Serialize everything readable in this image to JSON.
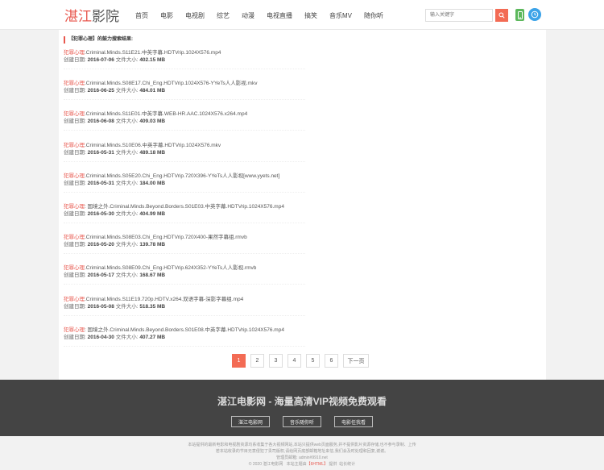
{
  "header": {
    "logo_red": "湛江",
    "logo_rest": "影院",
    "nav": [
      "首页",
      "电影",
      "电视剧",
      "综艺",
      "动漫",
      "电视直播",
      "搞笑",
      "音乐MV",
      "随你听"
    ],
    "search_placeholder": "输入关键字"
  },
  "section_title": "【犯罪心理】的鼓力搜索结果:",
  "results": [
    {
      "hl": "犯罪心理",
      "rest": ".Criminal.Minds.S11E21.中英字幕.HDTVrip.1024X576.mp4",
      "date_label": "创建日期:",
      "date": "2016-07-06",
      "size_label": "文件大小:",
      "size": "402.15 MB"
    },
    {
      "hl": "犯罪心理",
      "rest": ".Criminal.Minds.S08E17.Chi_Eng.HDTVrip.1024X576-YYeTs人人影视.mkv",
      "date_label": "创建日期:",
      "date": "2016-06-25",
      "size_label": "文件大小:",
      "size": "484.01 MB"
    },
    {
      "hl": "犯罪心理",
      "rest": ".Criminal.Minds.S11E01.中英字幕.WEB-HR.AAC.1024X576.x264.mp4",
      "date_label": "创建日期:",
      "date": "2016-06-08",
      "size_label": "文件大小:",
      "size": "409.03 MB"
    },
    {
      "hl": "犯罪心理",
      "rest": ".Criminal.Minds.S10E06.中英字幕.HDTVrip.1024X576.mkv",
      "date_label": "创建日期:",
      "date": "2016-05-31",
      "size_label": "文件大小:",
      "size": "489.18 MB"
    },
    {
      "hl": "犯罪心理",
      "rest": ".Criminal.Minds.S05E20.Chi_Eng.HDTVrip.720X396-YYeTs人人影视[www.yyets.net]",
      "date_label": "创建日期:",
      "date": "2016-05-31",
      "size_label": "文件大小:",
      "size": "184.00 MB"
    },
    {
      "hl": "犯罪心理",
      "rest": ": 国境之外.Criminal.Minds.Beyond.Borders.S01E03.中英字幕.HDTVrip.1024X576.mp4",
      "date_label": "创建日期:",
      "date": "2016-05-30",
      "size_label": "文件大小:",
      "size": "404.99 MB"
    },
    {
      "hl": "犯罪心理",
      "rest": ".Criminal.Minds.S08E03.Chi_Eng.HDTVrip.720X400-果然字幕组.rmvb",
      "date_label": "创建日期:",
      "date": "2016-05-20",
      "size_label": "文件大小:",
      "size": "139.78 MB"
    },
    {
      "hl": "犯罪心理",
      "rest": ".Criminal.Minds.S08E09.Chi_Eng.HDTVrip.624X352-YYeTs人人影视.rmvb",
      "date_label": "创建日期:",
      "date": "2016-05-17",
      "size_label": "文件大小:",
      "size": "168.67 MB"
    },
    {
      "hl": "犯罪心理",
      "rest": ".Criminal.Minds.S11E19.720p.HDTV.x264.双语字幕-深影字幕组.mp4",
      "date_label": "创建日期:",
      "date": "2016-05-08",
      "size_label": "文件大小:",
      "size": "518.35 MB"
    },
    {
      "hl": "犯罪心理",
      "rest": ": 国境之外.Criminal.Minds.Beyond.Borders.S01E08.中英字幕.HDTVrip.1024X576.mp4",
      "date_label": "创建日期:",
      "date": "2016-04-30",
      "size_label": "文件大小:",
      "size": "407.27 MB"
    }
  ],
  "pager": {
    "pages": [
      "1",
      "2",
      "3",
      "4",
      "5",
      "6"
    ],
    "next": "下一页",
    "current": "1"
  },
  "footer": {
    "slogan": "湛江电影网 - 海量高清VIP视频免费观看",
    "buttons": [
      "湛江电影网",
      "音乐随你听",
      "电影任我看"
    ],
    "disclaimer_1": "本站提供的最新电影和电视剧资源均系收集于各大视频网站,本站只提供web页面服务,并不提供影片资源存储,也不参与录制、上传",
    "disclaimer_2": "若本站收录的节目无意侵犯了贵司版权,请给网页底部邮箱地址来信,我们会及时处理和回复,谢谢。",
    "email": "管理员邮箱: admin#9910.net",
    "copyright": "© 2020 湛江电影网",
    "theme_text": "本站主题由",
    "theme_name": "【6HTML】",
    "theme_suffix": "提供",
    "stats": "站长统计"
  }
}
